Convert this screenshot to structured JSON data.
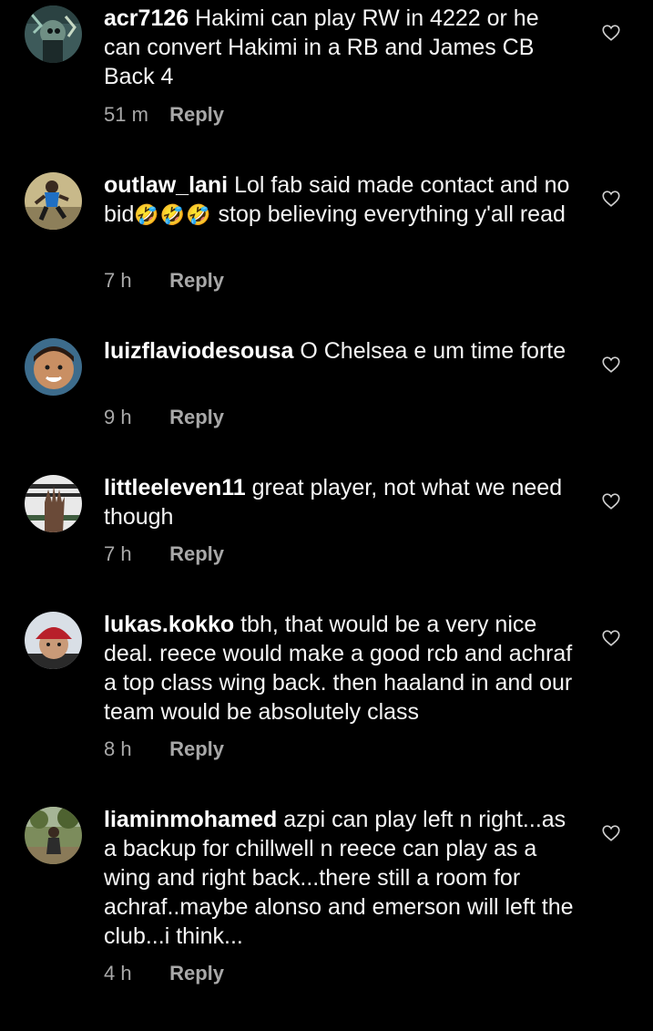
{
  "colors": {
    "background": "#000000",
    "text": "#f5f5f5",
    "meta": "#a8a8a8"
  },
  "comments": [
    {
      "username": "acr7126",
      "text": "Hakimi can play RW in 4222 or he can convert Hakimi in a RB and James CB Back 4",
      "time": "51 m",
      "reply_label": "Reply",
      "avatar_icon": "avatar-graffiti-icon"
    },
    {
      "username": "outlaw_lani",
      "text_before": "Lol fab said made contact and no bid",
      "emoji": "🤣🤣🤣",
      "text_after": " stop believing everything y'all read",
      "time": "7 h",
      "reply_label": "Reply",
      "avatar_icon": "avatar-player-icon"
    },
    {
      "username": "luizflaviodesousa",
      "text": "O Chelsea e um time forte",
      "time": "9 h",
      "reply_label": "Reply",
      "avatar_icon": "avatar-child-icon"
    },
    {
      "username": "littleeleven11",
      "text": "great player, not what we need though",
      "time": "7 h",
      "reply_label": "Reply",
      "avatar_icon": "avatar-hand-icon"
    },
    {
      "username": "lukas.kokko",
      "text": "tbh, that would be a very nice deal. reece would make a good rcb and achraf a top class wing back. then haaland in and our team would be absolutely class",
      "time": "8 h",
      "reply_label": "Reply",
      "avatar_icon": "avatar-cap-icon"
    },
    {
      "username": "liaminmohamed",
      "text": "azpi can play left n right...as a backup for chillwell n reece can play as a wing and right back...there still a room for achraf..maybe alonso and emerson will left the club...i think...",
      "time": "4 h",
      "reply_label": "Reply",
      "avatar_icon": "avatar-outdoor-icon"
    }
  ]
}
